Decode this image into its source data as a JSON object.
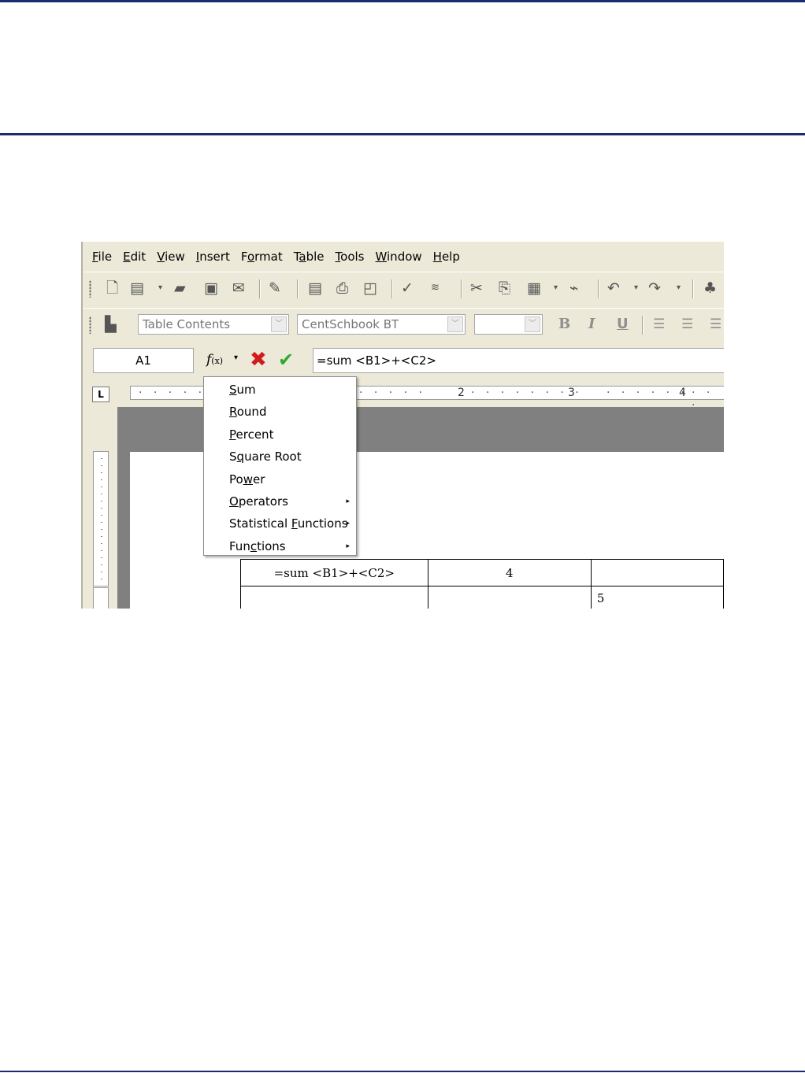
{
  "menubar": {
    "items": [
      {
        "pre": "",
        "key": "F",
        "post": "ile"
      },
      {
        "pre": "",
        "key": "E",
        "post": "dit"
      },
      {
        "pre": "",
        "key": "V",
        "post": "iew"
      },
      {
        "pre": "",
        "key": "I",
        "post": "nsert"
      },
      {
        "pre": "F",
        "key": "o",
        "post": "rmat"
      },
      {
        "pre": "T",
        "key": "a",
        "post": "ble"
      },
      {
        "pre": "",
        "key": "T",
        "post": "ools"
      },
      {
        "pre": "",
        "key": "W",
        "post": "indow"
      },
      {
        "pre": "",
        "key": "H",
        "post": "elp"
      }
    ]
  },
  "formatting": {
    "style": "Table Contents",
    "font": "CentSchbook BT",
    "size": "",
    "bold": "B",
    "italic": "I",
    "underline": "U"
  },
  "formula_bar": {
    "cell_ref": "A1",
    "formula": "=sum <B1>+<C2>"
  },
  "ruler": {
    "marks": [
      "2",
      "3",
      "4"
    ]
  },
  "table": {
    "rows": [
      [
        "=sum <B1>+<C2>",
        "4",
        ""
      ],
      [
        "",
        "",
        "5"
      ]
    ]
  },
  "formula_menu": {
    "items": [
      {
        "pre": "",
        "key": "S",
        "post": "um",
        "submenu": false
      },
      {
        "pre": "",
        "key": "R",
        "post": "ound",
        "submenu": false
      },
      {
        "pre": "",
        "key": "P",
        "post": "ercent",
        "submenu": false
      },
      {
        "pre": "S",
        "key": "q",
        "post": "uare Root",
        "submenu": false
      },
      {
        "pre": "Po",
        "key": "w",
        "post": "er",
        "submenu": false
      },
      {
        "pre": "",
        "key": "O",
        "post": "perators",
        "submenu": true
      },
      {
        "pre": "Statistical ",
        "key": "F",
        "post": "unctions",
        "submenu": true
      },
      {
        "pre": "Fun",
        "key": "c",
        "post": "tions",
        "submenu": true
      }
    ]
  },
  "icons": {
    "submenu_arrow": "▸",
    "dropdown_arrow": "▾",
    "cancel": "✖",
    "accept": "✔"
  }
}
